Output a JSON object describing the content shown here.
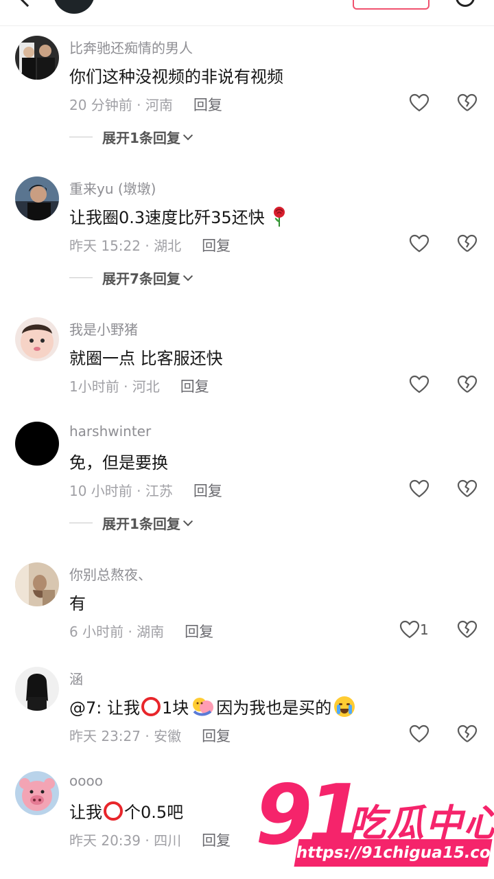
{
  "comments": [
    {
      "username": "比奔驰还痴情的男人",
      "text": "你们这种没视频的非说有视频",
      "time_location": "20 分钟前 · 河南",
      "reply_label": "回复",
      "expand_label": "展开1条回复"
    },
    {
      "username": "重来yu (墩墩)",
      "text": "让我圈0.3速度比歼35还快",
      "text_icon": "rose-emoji",
      "time_location": "昨天 15:22 · 湖北",
      "reply_label": "回复",
      "expand_label": "展开7条回复"
    },
    {
      "username": "我是小野猪",
      "text": "就圈一点 比客服还快",
      "time_location": "1小时前 · 河北",
      "reply_label": "回复"
    },
    {
      "username": "harshwinter",
      "text": "免，但是要换",
      "time_location": "10 小时前 · 江苏",
      "reply_label": "回复",
      "expand_label": "展开1条回复"
    },
    {
      "username": "你别总熬夜、",
      "text": "有",
      "time_location": "6 小时前 · 湖南",
      "reply_label": "回复",
      "like_count": "1"
    },
    {
      "username": "涵",
      "text_parts": [
        "@7: 让我",
        "1块",
        "因为我也是买的"
      ],
      "text_icons": [
        "red-circle-emoji",
        "hug-emoji",
        "crying-emoji"
      ],
      "time_location": "昨天 23:27 · 安徽",
      "reply_label": "回复"
    },
    {
      "username": "oooo",
      "text_parts": [
        "让我",
        "个0.5吧"
      ],
      "text_icons": [
        "red-circle-emoji"
      ],
      "time_location": "昨天 20:39 · 四川",
      "reply_label": "回复"
    }
  ],
  "icons": {
    "like": "heart-outline-icon",
    "dislike": "broken-heart-icon",
    "expand": "chevron-down-icon"
  },
  "watermark": {
    "number": "91",
    "text": "吃瓜中心",
    "url": "https://91chigua15.com"
  },
  "colors": {
    "accent": "#f5246b",
    "username": "#8e8e93",
    "meta": "#a0a0a5"
  }
}
